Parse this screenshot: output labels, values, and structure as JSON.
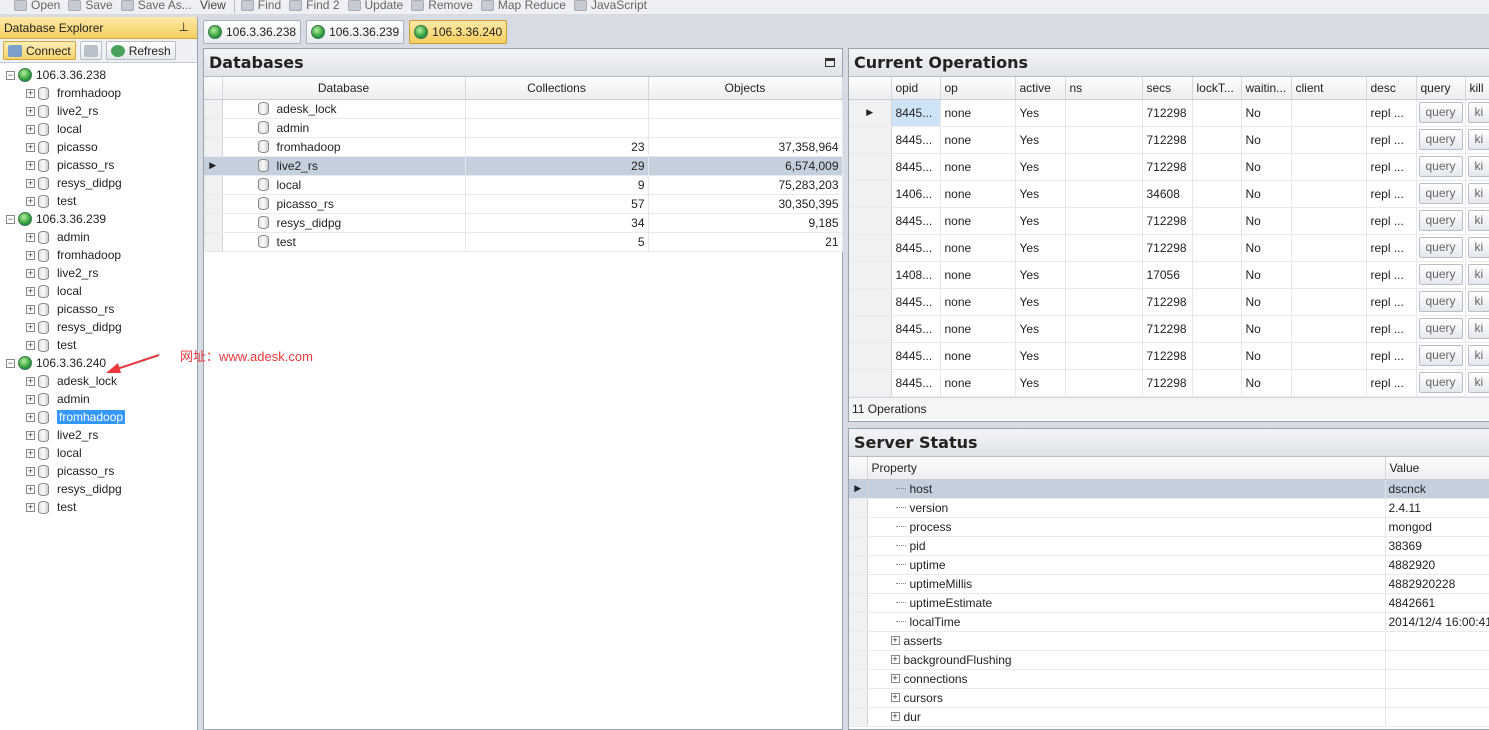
{
  "toolbar": {
    "items": [
      "Open",
      "Save",
      "Save As...",
      "View",
      "Find",
      "Find 2",
      "Update",
      "Remove",
      "Map Reduce",
      "JavaScript"
    ]
  },
  "explorer": {
    "title": "Database Explorer",
    "connect_label": "Connect",
    "refresh_label": "Refresh",
    "servers": [
      {
        "name": "106.3.36.238",
        "dbs": [
          "fromhadoop",
          "live2_rs",
          "local",
          "picasso",
          "picasso_rs",
          "resys_didpg",
          "test"
        ]
      },
      {
        "name": "106.3.36.239",
        "dbs": [
          "admin",
          "fromhadoop",
          "live2_rs",
          "local",
          "picasso_rs",
          "resys_didpg",
          "test"
        ]
      },
      {
        "name": "106.3.36.240",
        "dbs": [
          "adesk_lock",
          "admin",
          "fromhadoop",
          "live2_rs",
          "local",
          "picasso_rs",
          "resys_didpg",
          "test"
        ]
      }
    ],
    "selected": "fromhadoop"
  },
  "annotation": "网址：www.adesk.com",
  "tabs": [
    "106.3.36.238",
    "106.3.36.239",
    "106.3.36.240"
  ],
  "active_tab": "106.3.36.240",
  "databases": {
    "title": "Databases",
    "columns": [
      "Database",
      "Collections",
      "Objects"
    ],
    "rows": [
      {
        "name": "adesk_lock",
        "collections": "",
        "objects": ""
      },
      {
        "name": "admin",
        "collections": "",
        "objects": ""
      },
      {
        "name": "fromhadoop",
        "collections": "23",
        "objects": "37,358,964"
      },
      {
        "name": "live2_rs",
        "collections": "29",
        "objects": "6,574,009"
      },
      {
        "name": "local",
        "collections": "9",
        "objects": "75,283,203"
      },
      {
        "name": "picasso_rs",
        "collections": "57",
        "objects": "30,350,395"
      },
      {
        "name": "resys_didpg",
        "collections": "34",
        "objects": "9,185"
      },
      {
        "name": "test",
        "collections": "5",
        "objects": "21"
      }
    ]
  },
  "operations": {
    "title": "Current Operations",
    "columns": [
      "opid",
      "op",
      "active",
      "ns",
      "secs",
      "lockT...",
      "waitin...",
      "client",
      "desc",
      "query",
      "kill"
    ],
    "rows": [
      [
        "8445...",
        "none",
        "Yes",
        "",
        "712298",
        "",
        "No",
        "",
        "repl ...",
        "query",
        "ki"
      ],
      [
        "8445...",
        "none",
        "Yes",
        "",
        "712298",
        "",
        "No",
        "",
        "repl ...",
        "query",
        "ki"
      ],
      [
        "8445...",
        "none",
        "Yes",
        "",
        "712298",
        "",
        "No",
        "",
        "repl ...",
        "query",
        "ki"
      ],
      [
        "1406...",
        "none",
        "Yes",
        "",
        "34608",
        "",
        "No",
        "",
        "repl ...",
        "query",
        "ki"
      ],
      [
        "8445...",
        "none",
        "Yes",
        "",
        "712298",
        "",
        "No",
        "",
        "repl ...",
        "query",
        "ki"
      ],
      [
        "8445...",
        "none",
        "Yes",
        "",
        "712298",
        "",
        "No",
        "",
        "repl ...",
        "query",
        "ki"
      ],
      [
        "1408...",
        "none",
        "Yes",
        "",
        "17056",
        "",
        "No",
        "",
        "repl ...",
        "query",
        "ki"
      ],
      [
        "8445...",
        "none",
        "Yes",
        "",
        "712298",
        "",
        "No",
        "",
        "repl ...",
        "query",
        "ki"
      ],
      [
        "8445...",
        "none",
        "Yes",
        "",
        "712298",
        "",
        "No",
        "",
        "repl ...",
        "query",
        "ki"
      ],
      [
        "8445...",
        "none",
        "Yes",
        "",
        "712298",
        "",
        "No",
        "",
        "repl ...",
        "query",
        "ki"
      ],
      [
        "8445...",
        "none",
        "Yes",
        "",
        "712298",
        "",
        "No",
        "",
        "repl ...",
        "query",
        "ki"
      ]
    ],
    "footer": "11 Operations"
  },
  "server_status": {
    "title": "Server Status",
    "columns": [
      "Property",
      "Value"
    ],
    "rows": [
      {
        "property": "host",
        "value": "dscnck",
        "expandable": false
      },
      {
        "property": "version",
        "value": "2.4.11",
        "expandable": false
      },
      {
        "property": "process",
        "value": "mongod",
        "expandable": false
      },
      {
        "property": "pid",
        "value": "38369",
        "expandable": false
      },
      {
        "property": "uptime",
        "value": "4882920",
        "expandable": false
      },
      {
        "property": "uptimeMillis",
        "value": "4882920228",
        "expandable": false
      },
      {
        "property": "uptimeEstimate",
        "value": "4842661",
        "expandable": false
      },
      {
        "property": "localTime",
        "value": "2014/12/4 16:00:41",
        "expandable": false
      },
      {
        "property": "asserts",
        "value": "",
        "expandable": true
      },
      {
        "property": "backgroundFlushing",
        "value": "",
        "expandable": true
      },
      {
        "property": "connections",
        "value": "",
        "expandable": true
      },
      {
        "property": "cursors",
        "value": "",
        "expandable": true
      },
      {
        "property": "dur",
        "value": "",
        "expandable": true
      }
    ]
  }
}
